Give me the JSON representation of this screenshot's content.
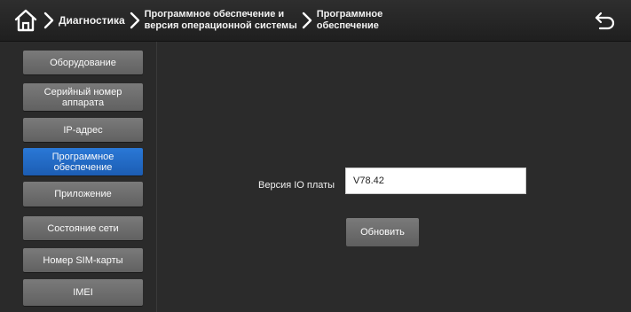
{
  "header": {
    "breadcrumbs": [
      "Диагностика",
      "Программное обеспечение и версия операционной системы",
      "Программное обеспечение"
    ],
    "crumb2_line1": "Программное обеспечение и",
    "crumb2_line2": "версия операционной системы",
    "crumb3_line1": "Программное",
    "crumb3_line2": "обеспечение",
    "icons": [
      "home-icon",
      "chevron-right-icon",
      "back-arrow-icon"
    ]
  },
  "sidebar": {
    "items": [
      {
        "label": "Оборудование",
        "active": false
      },
      {
        "label": "Серийный номер аппарата",
        "active": false
      },
      {
        "label": "IP-адрес",
        "active": false
      },
      {
        "label": "Программное обеспечение",
        "active": true
      },
      {
        "label": "Приложение",
        "active": false
      },
      {
        "label": "Состояние сети",
        "active": false
      },
      {
        "label": "Номер SIM-карты",
        "active": false
      },
      {
        "label": "IMEI",
        "active": false
      }
    ],
    "active_color": "#2a78d6"
  },
  "main": {
    "version_label": "Версия IO платы",
    "version_value": "V78.42",
    "update_label": "Обновить"
  }
}
